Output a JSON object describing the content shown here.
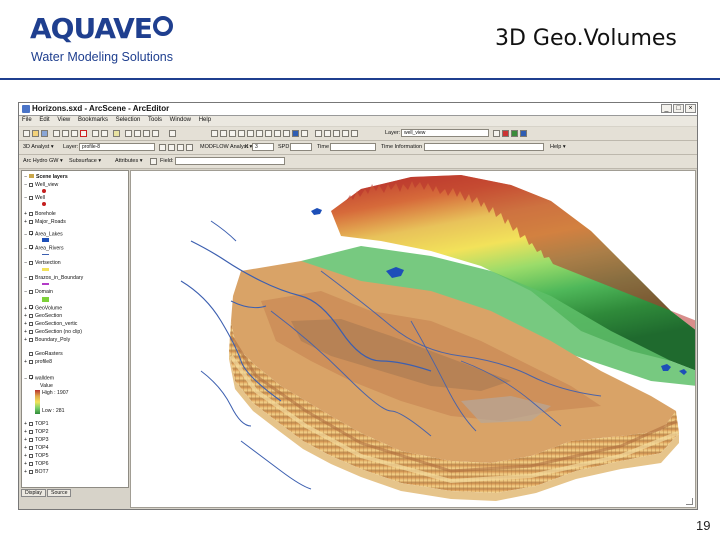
{
  "slide": {
    "logo_text": "AQUAVE",
    "logo_tagline": "Water Modeling Solutions",
    "title": "3D Geo.Volumes",
    "page_number": "19"
  },
  "window": {
    "title": "Horizons.sxd - ArcScene - ArcEditor",
    "controls": [
      "_",
      "□",
      "×"
    ]
  },
  "menu": [
    "File",
    "Edit",
    "View",
    "Bookmarks",
    "Selection",
    "Tools",
    "Window",
    "Help"
  ],
  "toolbar1": {
    "layer_label": "Layer:",
    "layer_value": "well_view"
  },
  "toolbar2": {
    "analyst_label": "3D Analyst ▾",
    "layer_label": "Layer:",
    "layer_value": "profile-8",
    "modflow_label": "MODFLOW Analyst ▾",
    "k_label": "K",
    "k_value": "3",
    "spd_label": "SPD",
    "time_label": "Time",
    "time_info_label": "Time Information",
    "help_label": "Help ▾"
  },
  "toolbar3": {
    "arc_hydro_label": "Arc Hydro GW ▾",
    "subsurface_label": "Subsurface ▾",
    "attributes_label": "Attributes ▾",
    "field_label": "Field:"
  },
  "toc": {
    "root": "Scene layers",
    "layers": [
      "Well_view",
      "Well",
      "Borehole",
      "Major_Roads",
      "Area_Lakes",
      "Area_Rivers",
      "Vertsection",
      "Brazos_in_Boundary",
      "Domain",
      "GeoVolume",
      "GeoSection",
      "GeoSection_vertic",
      "GeoSection (no clip)",
      "Boundary_Poly",
      "GeoRasters",
      "profile8",
      "walldem"
    ],
    "legend": {
      "value_label": "Value",
      "high": "High : 1907",
      "low": "Low : 281"
    },
    "tops": [
      "TOP1",
      "TOP2",
      "TOP3",
      "TOP4",
      "TOP5",
      "TOP6",
      "BOT7"
    ],
    "tabs": [
      "Display",
      "Source"
    ]
  },
  "colors": {
    "brand_blue": "#1f3f8f",
    "header_band": "#ffffff"
  },
  "icons": [
    "app-icon",
    "folder-icon",
    "save-icon",
    "zoom-icon",
    "pan-icon",
    "navigate-icon",
    "identify-icon"
  ]
}
